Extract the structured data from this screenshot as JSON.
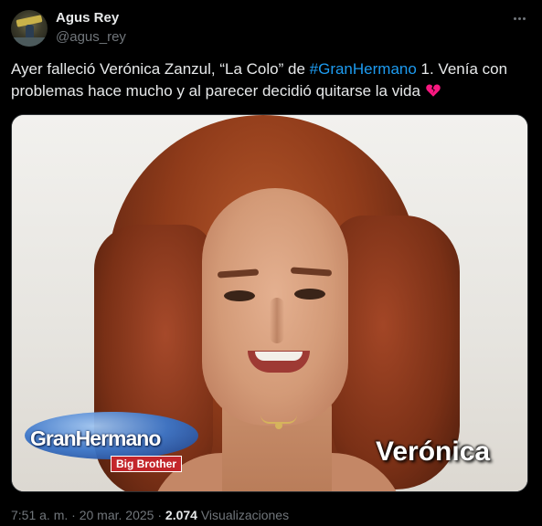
{
  "author": {
    "name": "Agus Rey",
    "handle": "@agus_rey"
  },
  "tweet": {
    "text_before": "Ayer falleció Verónica Zanzul, “La Colo” de ",
    "hashtag": "#GranHermano",
    "text_after": " 1. Venía con problemas hace mucho y al parecer decidió quitarse la vida ",
    "emoji_icon": "broken-heart-icon"
  },
  "media": {
    "logo_text": "GranHermano",
    "logo_badge": "Big Brother",
    "caption": "Verónica"
  },
  "meta": {
    "time": "7:51 a. m.",
    "separator": " · ",
    "date": "20 mar. 2025",
    "separator2": " · ",
    "views_count": "2.074",
    "views_label": " Visualizaciones"
  },
  "colors": {
    "background": "#000000",
    "text": "#e7e9ea",
    "secondary": "#71767b",
    "link": "#1d9bf0",
    "heart": "#f91880"
  }
}
